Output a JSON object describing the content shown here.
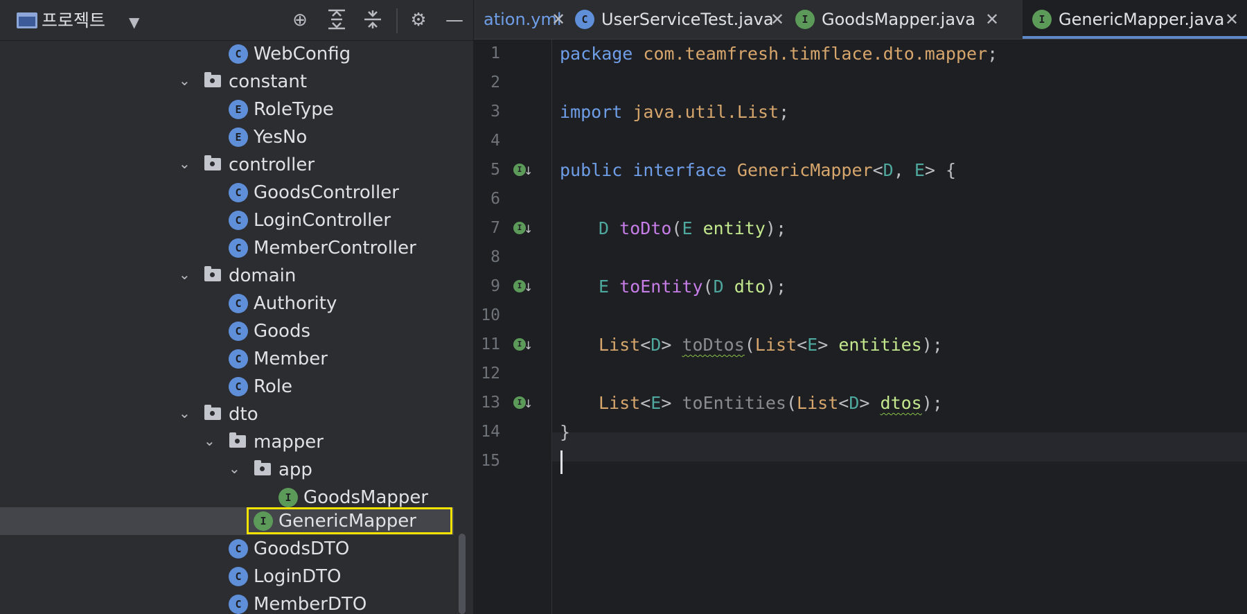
{
  "project_panel": {
    "title": "프로젝트",
    "toolbar_icons": [
      "crosshair-icon",
      "expand-all-icon",
      "collapse-all-icon",
      "gear-icon",
      "minimize-icon"
    ]
  },
  "tree": [
    {
      "label": "WebConfig",
      "badge": "C",
      "kind": "class"
    },
    {
      "label": "constant",
      "kind": "folder",
      "expanded": true
    },
    {
      "label": "RoleType",
      "badge": "E",
      "kind": "enum"
    },
    {
      "label": "YesNo",
      "badge": "E",
      "kind": "enum"
    },
    {
      "label": "controller",
      "kind": "folder",
      "expanded": true
    },
    {
      "label": "GoodsController",
      "badge": "C",
      "kind": "class"
    },
    {
      "label": "LoginController",
      "badge": "C",
      "kind": "class"
    },
    {
      "label": "MemberController",
      "badge": "C",
      "kind": "class"
    },
    {
      "label": "domain",
      "kind": "folder",
      "expanded": true
    },
    {
      "label": "Authority",
      "badge": "C",
      "kind": "class"
    },
    {
      "label": "Goods",
      "badge": "C",
      "kind": "class"
    },
    {
      "label": "Member",
      "badge": "C",
      "kind": "class"
    },
    {
      "label": "Role",
      "badge": "C",
      "kind": "class"
    },
    {
      "label": "dto",
      "kind": "folder",
      "expanded": true
    },
    {
      "label": "mapper",
      "kind": "folder",
      "expanded": true
    },
    {
      "label": "app",
      "kind": "folder",
      "expanded": true
    },
    {
      "label": "GoodsMapper",
      "badge": "I",
      "kind": "interface"
    },
    {
      "label": "GenericMapper",
      "badge": "I",
      "kind": "interface",
      "selected": true
    },
    {
      "label": "GoodsDTO",
      "badge": "C",
      "kind": "class"
    },
    {
      "label": "LoginDTO",
      "badge": "C",
      "kind": "class"
    },
    {
      "label": "MemberDTO",
      "badge": "C",
      "kind": "class"
    }
  ],
  "tabs": [
    {
      "label": "ation.yml",
      "close": "✕"
    },
    {
      "label": "UserServiceTest.java",
      "badge": "C",
      "close": "✕"
    },
    {
      "label": "GoodsMapper.java",
      "badge": "I",
      "close": "✕"
    },
    {
      "label": "GenericMapper.java",
      "badge": "I",
      "close": "✕",
      "active": true
    }
  ],
  "editor": {
    "line_numbers": [
      "1",
      "2",
      "3",
      "4",
      "5",
      "6",
      "7",
      "8",
      "9",
      "10",
      "11",
      "12",
      "13",
      "14",
      "15"
    ],
    "implementation_marker_lines": [
      5,
      7,
      9,
      11,
      13
    ],
    "current_line": 15,
    "code": {
      "l1_kw": "package",
      "l1_pkg": "com.teamfresh.timflace.dto.mapper",
      "l1_end": ";",
      "l3_kw": "import",
      "l3_pkg": "java.util.List",
      "l3_end": ";",
      "l5_kw1": "public",
      "l5_kw2": "interface",
      "l5_name": "GenericMapper",
      "l5_lt": "<",
      "l5_t1": "D",
      "l5_comma": ", ",
      "l5_t2": "E",
      "l5_gt": ">",
      "l5_brace": " {",
      "l7_type": "D",
      "l7_method": "toDto",
      "l7_open": "(",
      "l7_ptype": "E",
      "l7_param": "entity",
      "l7_close": ");",
      "l9_type": "E",
      "l9_method": "toEntity",
      "l9_open": "(",
      "l9_ptype": "D",
      "l9_param": "dto",
      "l9_close": ");",
      "l11_list": "List",
      "l11_lt": "<",
      "l11_t": "D",
      "l11_gt": ">",
      "l11_method": "toDtos",
      "l11_open": "(",
      "l11_plist": "List",
      "l11_plt": "<",
      "l11_pt": "E",
      "l11_pgt": ">",
      "l11_param": "entities",
      "l11_close": ");",
      "l13_list": "List",
      "l13_lt": "<",
      "l13_t": "E",
      "l13_gt": ">",
      "l13_method": "toEntities",
      "l13_open": "(",
      "l13_plist": "List",
      "l13_plt": "<",
      "l13_pt": "D",
      "l13_pgt": ">",
      "l13_param": "dtos",
      "l13_close": ");",
      "l14_brace": "}"
    }
  },
  "colors": {
    "keyword": "#6f9ee8",
    "type": "#d7a66d",
    "type_param": "#4fa89e",
    "method": "#c77de8",
    "param": "#c3e88d",
    "selection_highlight": "#f5e300"
  }
}
